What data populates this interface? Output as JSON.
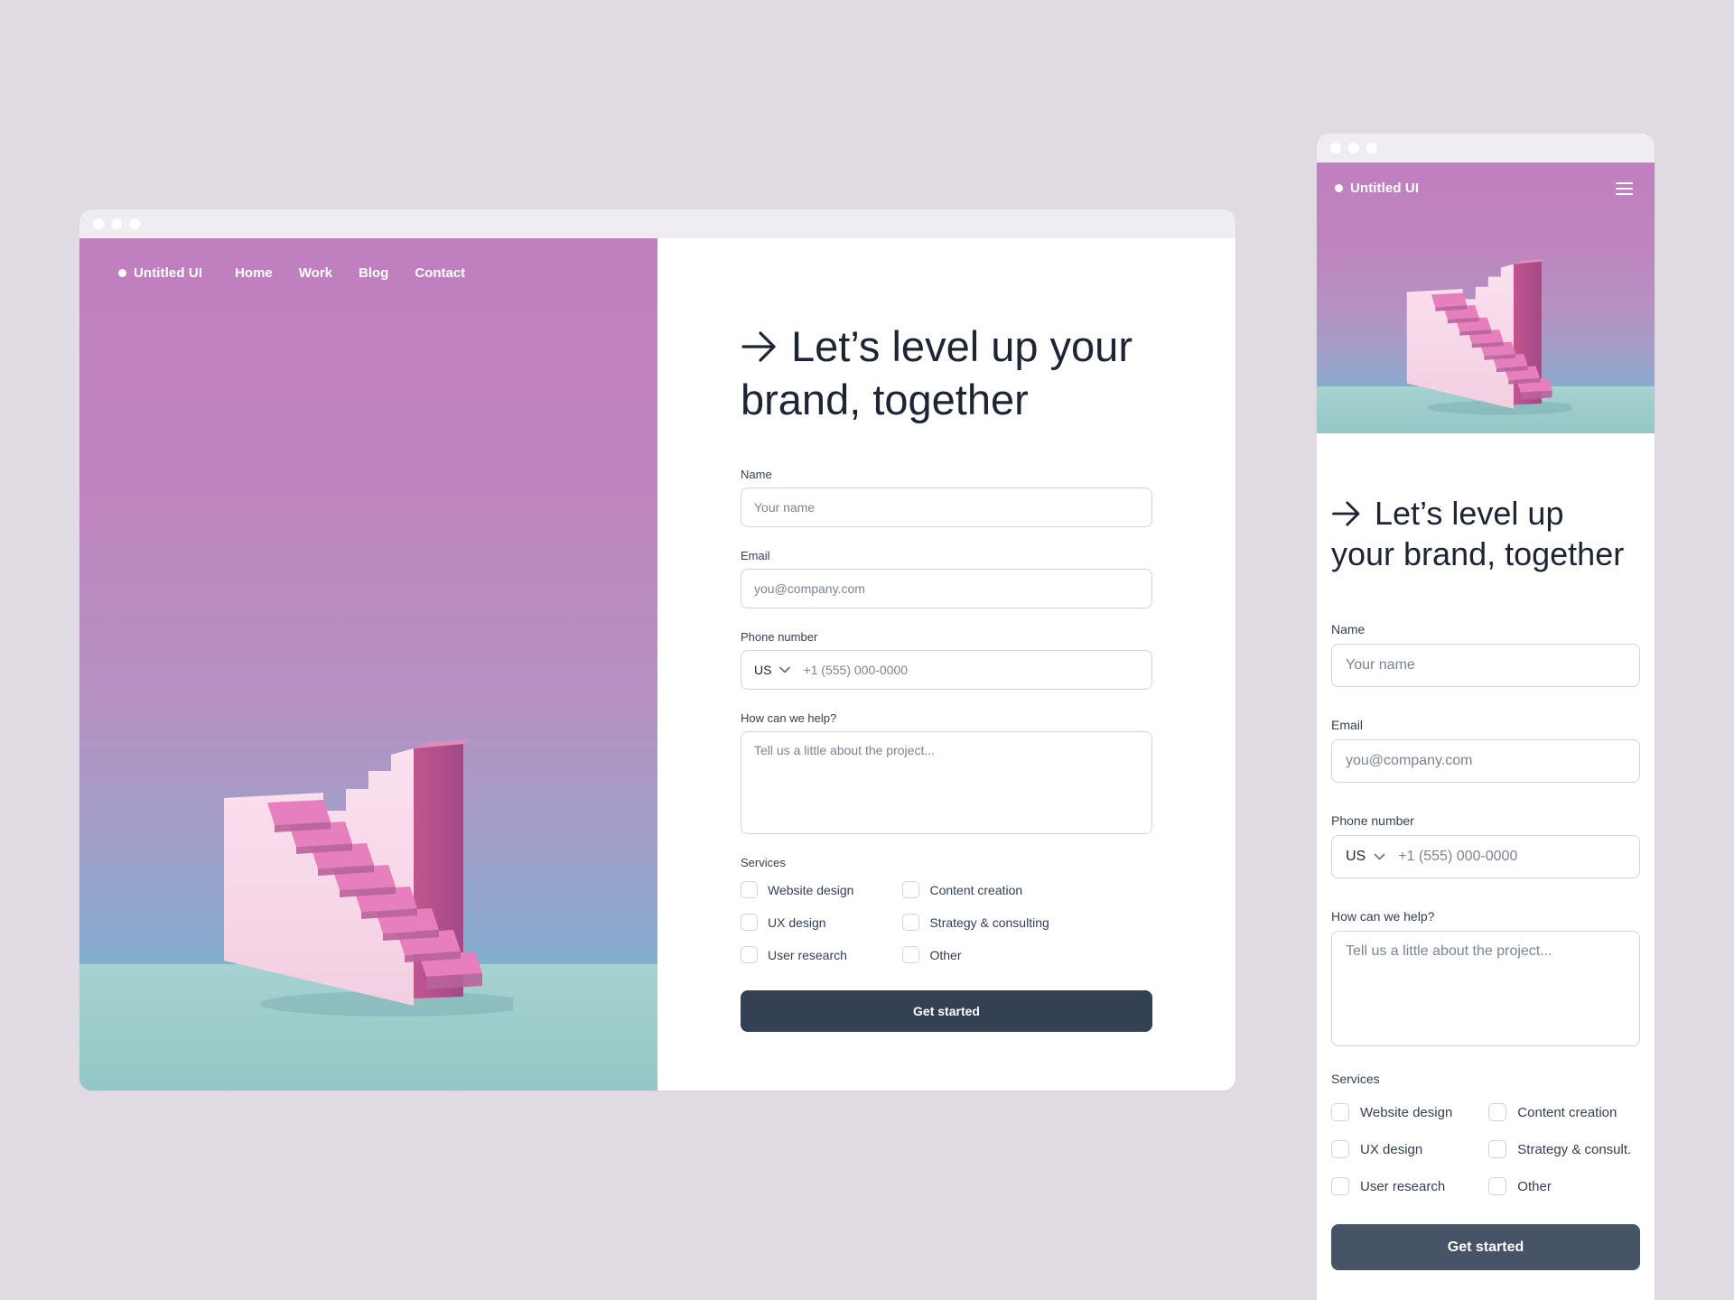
{
  "brand": {
    "name": "Untitled UI"
  },
  "desktop": {
    "nav": {
      "links": [
        "Home",
        "Work",
        "Blog",
        "Contact"
      ]
    },
    "headline": {
      "line1": "Let’s level up your",
      "line2": "brand, together"
    }
  },
  "mobile": {
    "headline": {
      "line1": "Let’s level up",
      "line2": "your brand, together"
    },
    "services": [
      "Website design",
      "Content creation",
      "UX design",
      "Strategy & consult.",
      "User research",
      "Other"
    ]
  },
  "form": {
    "name": {
      "label": "Name",
      "placeholder": "Your name"
    },
    "email": {
      "label": "Email",
      "placeholder": "you@company.com"
    },
    "phone": {
      "label": "Phone number",
      "country": "US",
      "placeholder": "+1 (555) 000-0000"
    },
    "message": {
      "label": "How can we help?",
      "placeholder": "Tell us a little about the project..."
    },
    "services_label": "Services",
    "services": [
      "Website design",
      "Content creation",
      "UX design",
      "Strategy & consulting",
      "User research",
      "Other"
    ],
    "submit": "Get started"
  },
  "icons": {
    "headline": "arrow-right-icon",
    "phone_dropdown": "chevron-down-icon",
    "menu": "hamburger-menu-icon"
  },
  "colors": {
    "hero_top": "#c07fbf",
    "hero_bottom": "#8ec3c6",
    "desktop_button": "#344054",
    "mobile_button": "#475467",
    "text": "#1d2433",
    "border": "#d0d5dd"
  }
}
